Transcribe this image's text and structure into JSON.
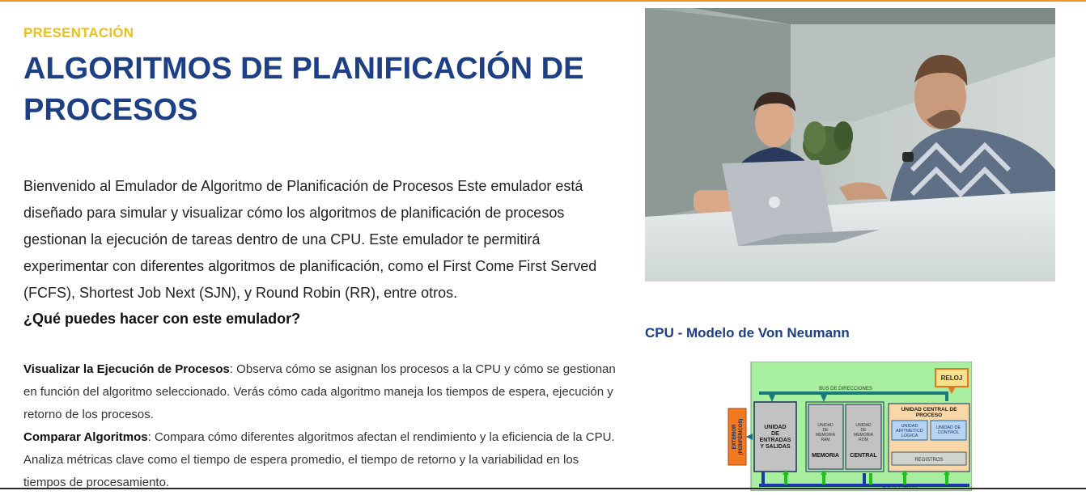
{
  "header": {
    "eyebrow": "PRESENTACIÓN",
    "title": "ALGORITMOS DE PLANIFICACIÓN DE PROCESOS"
  },
  "intro": {
    "paragraph": "Bienvenido al Emulador de Algoritmo de Planificación de Procesos Este emulador está diseñado para simular y visualizar cómo los algoritmos de planificación de procesos gestionan la ejecución de tareas dentro de una CPU. Este emulador te permitirá experimentar con diferentes algoritmos de planificación, como el First Come First Served (FCFS), Shortest Job Next (SJN), y Round Robin (RR), entre otros.",
    "question": "¿Qué puedes hacer con este emulador?"
  },
  "features": [
    {
      "title": "Visualizar la Ejecución de Procesos",
      "text": ": Observa cómo se asignan los procesos a la CPU y cómo se gestionan en función del algoritmo seleccionado. Verás cómo cada algoritmo maneja los tiempos de espera, ejecución y retorno de los procesos."
    },
    {
      "title": "Comparar Algoritmos",
      "text": ": Compara cómo diferentes algoritmos afectan el rendimiento y la eficiencia de la CPU. Analiza métricas clave como el tiempo de espera promedio, el tiempo de retorno y la variabilidad en los tiempos de procesamiento."
    }
  ],
  "cpu_section": {
    "title": "CPU - Modelo de Von Neumann",
    "diagram": {
      "bus_direcciones": "BUS DE DIRECCIONES",
      "reloj": "RELOJ",
      "exterior_1": "EXTERIOR",
      "exterior_2": "(PERIFÉRICOS)",
      "unidad_es_1": "UNIDAD",
      "unidad_es_2": "DE",
      "unidad_es_3": "ENTRADAS",
      "unidad_es_4": "Y SALIDAS",
      "ram_1": "UNIDAD",
      "ram_2": "DE",
      "ram_3": "MEMORIA",
      "ram_4": "RAM",
      "rom_1": "UNIDAD",
      "rom_2": "DE",
      "rom_3": "MEMORIA",
      "rom_4": "ROM",
      "memoria": "MEMORIA",
      "central": "CENTRAL",
      "ucp_1": "UNIDAD CENTRAL DE",
      "ucp_2": "PROCESO",
      "alu_1": "UNIDAD",
      "alu_2": "ARITMETICO",
      "alu_3": "LOGICA",
      "uc_1": "UNIDAD DE",
      "uc_2": "CONTROL",
      "registros": "REGISTROS",
      "bus_control": "BUS DE CONTROL"
    }
  }
}
